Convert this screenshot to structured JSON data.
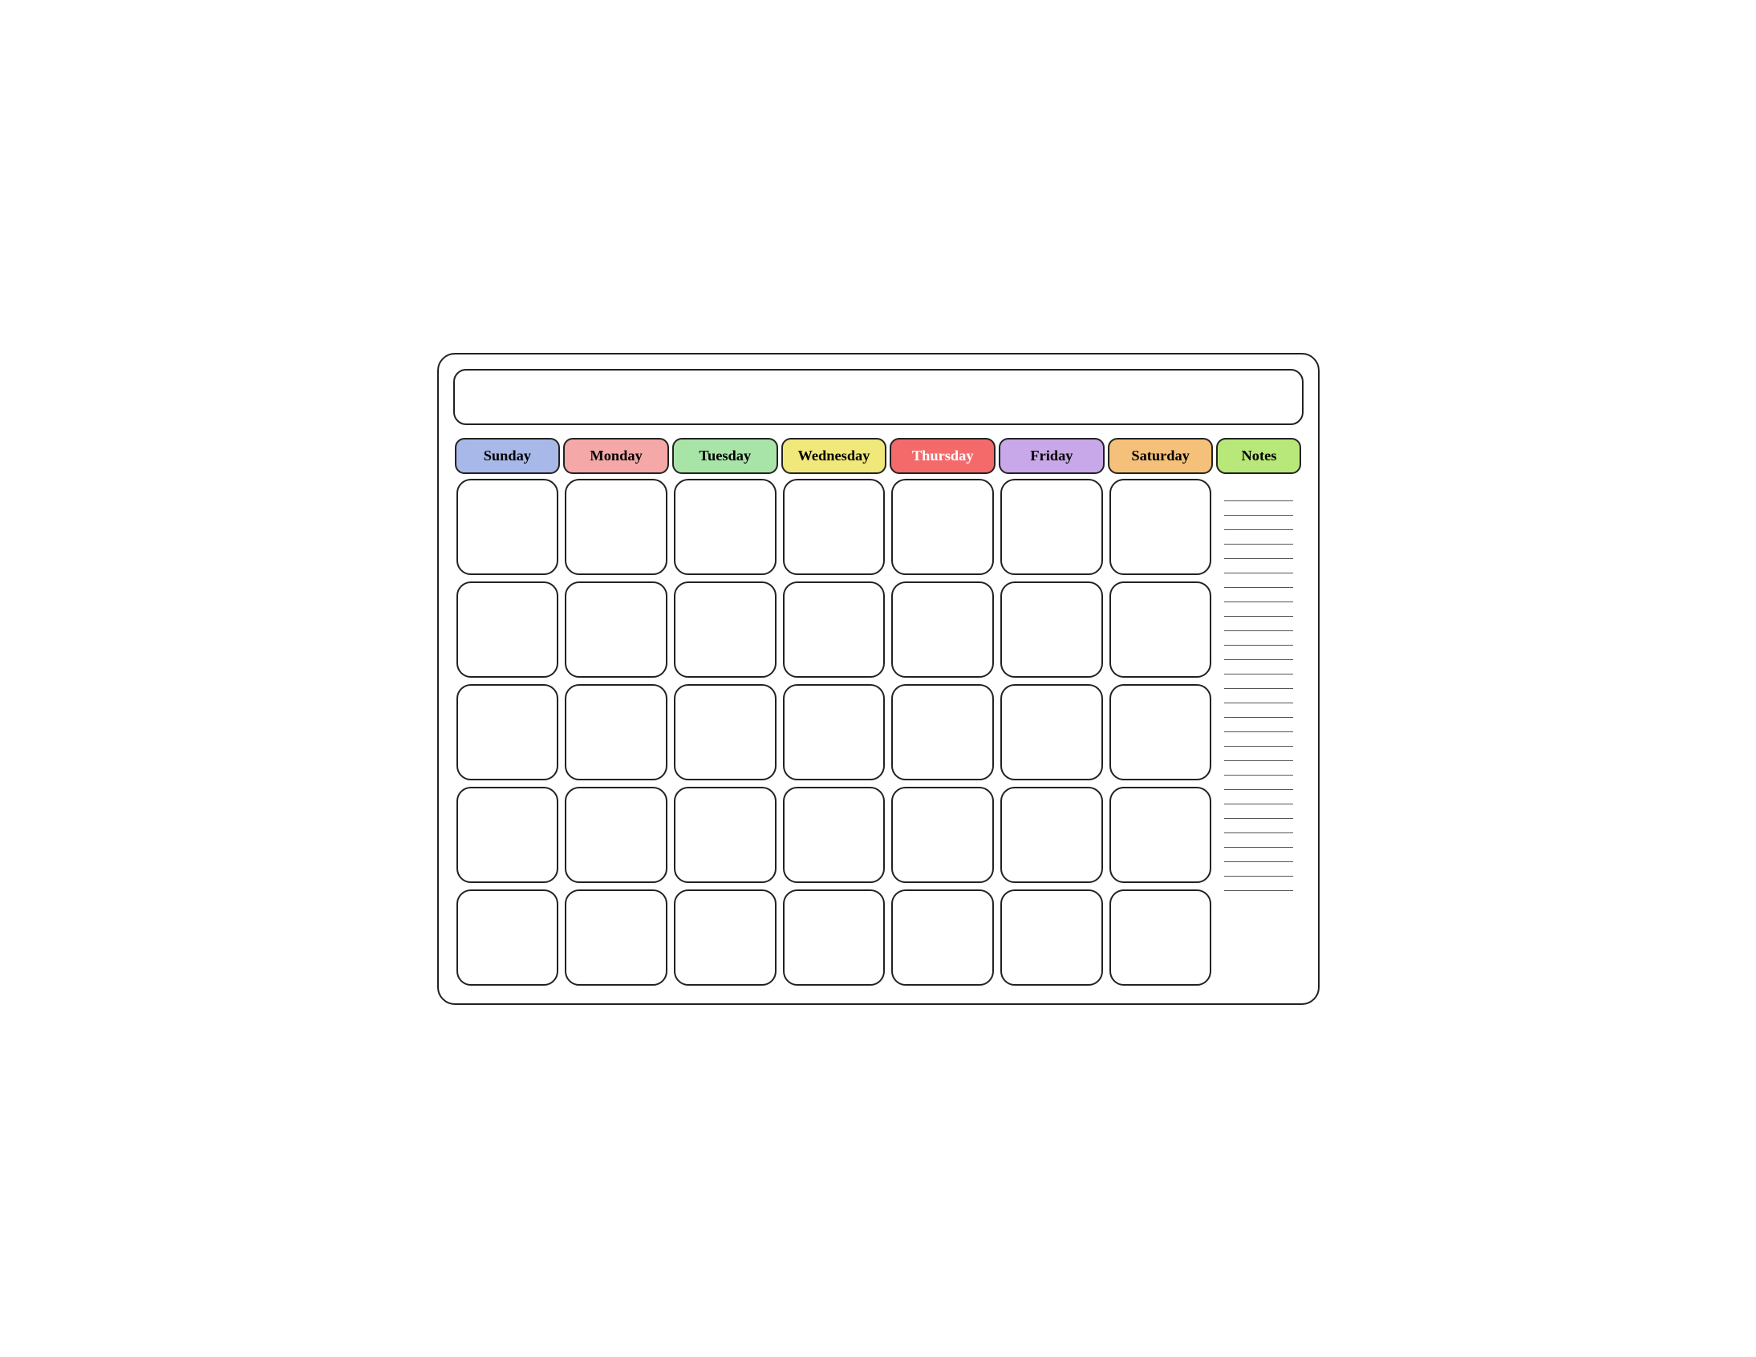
{
  "title": "",
  "headers": {
    "sunday": "Sunday",
    "monday": "Monday",
    "tuesday": "Tuesday",
    "wednesday": "Wednesday",
    "thursday": "Thursday",
    "friday": "Friday",
    "saturday": "Saturday",
    "notes": "Notes"
  },
  "colors": {
    "sunday": "#a8b8e8",
    "monday": "#f4a8a8",
    "tuesday": "#a8e4a8",
    "wednesday": "#f0e87a",
    "thursday": "#f46a6a",
    "friday": "#c8a8e8",
    "saturday": "#f4c07a",
    "notes": "#b8e87a"
  },
  "rows": 5,
  "notes_lines": 28
}
